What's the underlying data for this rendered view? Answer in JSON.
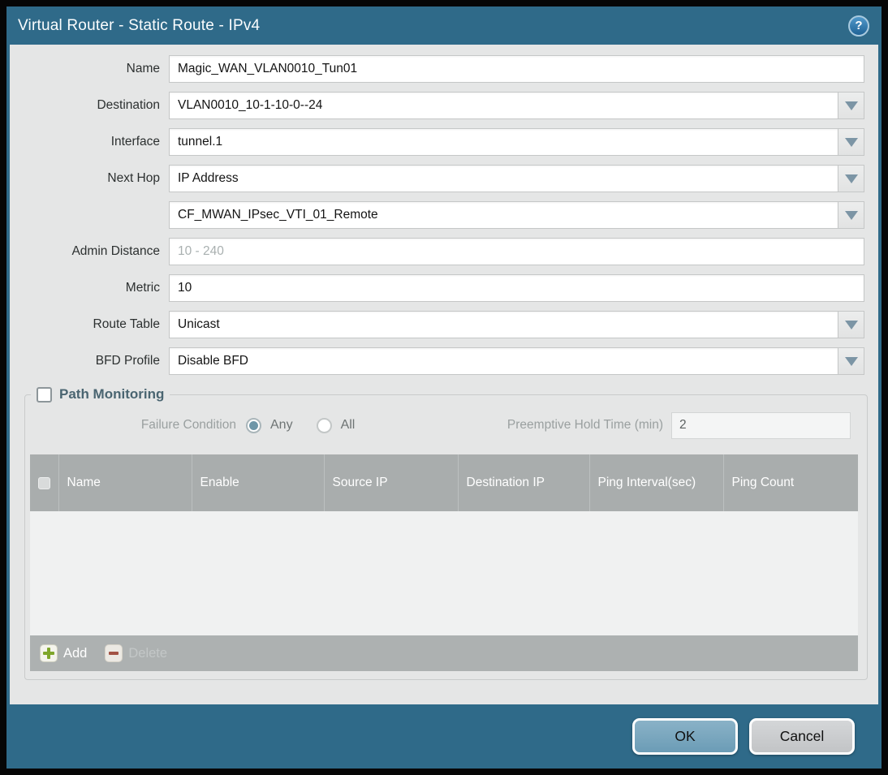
{
  "titlebar": {
    "title": "Virtual Router - Static Route - IPv4"
  },
  "form": {
    "name": {
      "label": "Name",
      "value": "Magic_WAN_VLAN0010_Tun01"
    },
    "destination": {
      "label": "Destination",
      "value": "VLAN0010_10-1-10-0--24"
    },
    "interface": {
      "label": "Interface",
      "value": "tunnel.1"
    },
    "next_hop": {
      "label": "Next Hop",
      "value": "IP Address"
    },
    "next_hop_address": {
      "value": "CF_MWAN_IPsec_VTI_01_Remote"
    },
    "admin_distance": {
      "label": "Admin Distance",
      "placeholder": "10 - 240"
    },
    "metric": {
      "label": "Metric",
      "value": "10"
    },
    "route_table": {
      "label": "Route Table",
      "value": "Unicast"
    },
    "bfd_profile": {
      "label": "BFD Profile",
      "value": "Disable BFD"
    }
  },
  "path_monitoring": {
    "legend": "Path Monitoring",
    "checked": false,
    "failure_condition": {
      "label": "Failure Condition",
      "options": [
        {
          "label": "Any",
          "selected": true
        },
        {
          "label": "All",
          "selected": false
        }
      ]
    },
    "preemptive_hold_time": {
      "label": "Preemptive Hold Time (min)",
      "value": "2"
    },
    "table": {
      "columns": [
        "Name",
        "Enable",
        "Source IP",
        "Destination IP",
        "Ping Interval(sec)",
        "Ping Count"
      ],
      "rows": []
    },
    "actions": {
      "add": "Add",
      "delete": "Delete"
    }
  },
  "buttons": {
    "ok": "OK",
    "cancel": "Cancel"
  },
  "icons": {
    "help": "?",
    "dropdown": "chevron-down",
    "add": "plus",
    "delete": "minus"
  },
  "colors": {
    "titlebar_teal": "#2F6A89",
    "content_gray": "#E5E6E6",
    "table_header_gray": "#A9ADAD",
    "ok_button_blue": "#77A6BE",
    "cancel_button_gray": "#C9CBCD",
    "selected_radio_teal": "#6E96A8",
    "add_icon_green": "#7FA62B",
    "delete_icon_red": "#A25244",
    "pm_caption": "#4A6571"
  }
}
